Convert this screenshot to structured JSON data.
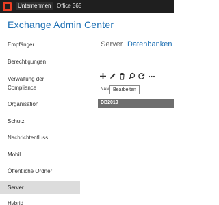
{
  "topbar": {
    "logo_icon": "office-logo-icon",
    "nav": [
      "Unternehmen",
      "Office 365"
    ]
  },
  "app": {
    "title": "Exchange Admin Center"
  },
  "sidebar": {
    "items": [
      {
        "label": "Empfänger"
      },
      {
        "label": "Berechtigungen"
      },
      {
        "label": "Verwaltung der\nCompliance"
      },
      {
        "label": "Organisation"
      },
      {
        "label": "Schutz"
      },
      {
        "label": "Nachrichtenfluss"
      },
      {
        "label": "Mobil"
      },
      {
        "label": "Öffentliche Ordner"
      },
      {
        "label": "Server",
        "selected": true
      },
      {
        "label": "Hybrid"
      }
    ]
  },
  "tabs": [
    {
      "label": "Server",
      "active": false
    },
    {
      "label": "Datenbanken",
      "active": true
    }
  ],
  "toolbar": {
    "icons": [
      "add-icon",
      "edit-icon",
      "delete-icon",
      "search-icon",
      "refresh-icon",
      "more-icon"
    ],
    "tooltip": "Bearbeiten"
  },
  "table": {
    "column_header": "NAM",
    "rows": [
      {
        "name": "DB2019",
        "selected": true
      }
    ]
  },
  "colors": {
    "accent": "#1d6fb3",
    "topbar": "#1f1f1f",
    "selected_nav": "#dcdcdc",
    "selected_row": "#6e6e6e",
    "logo": "#ea3e23"
  }
}
